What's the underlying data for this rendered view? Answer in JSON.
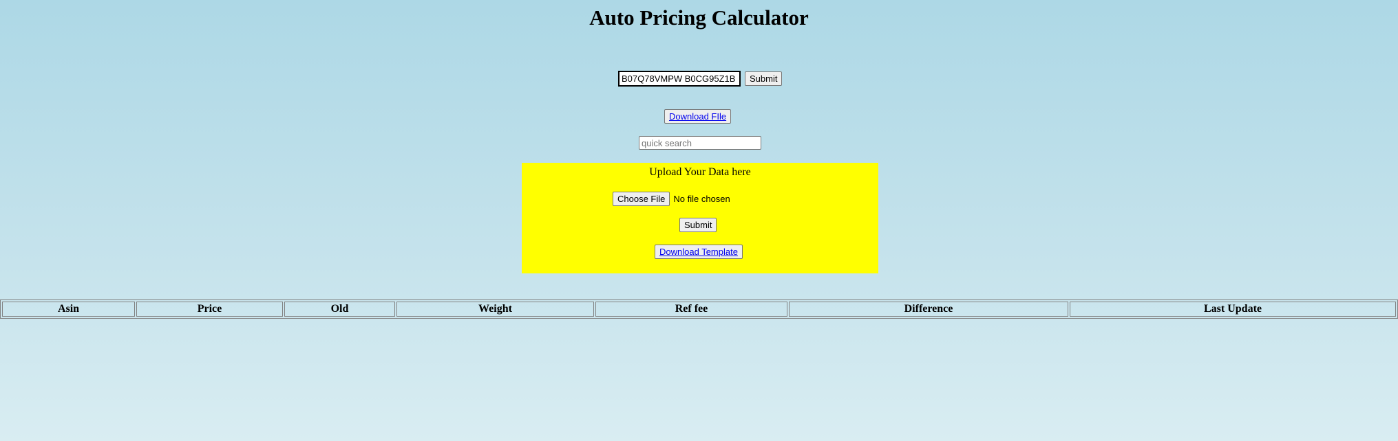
{
  "page": {
    "title": "Auto Pricing Calculator"
  },
  "asin_form": {
    "input_value": "B07Q78VMPW B0CG95Z1B",
    "submit_label": "Submit"
  },
  "download_file": {
    "label": "Download FIle"
  },
  "quick_search": {
    "placeholder": "quick search"
  },
  "upload": {
    "heading": "Upload Your Data here",
    "choose_file_label": "Choose File",
    "file_status": "No file chosen",
    "submit_label": "Submit",
    "template_label": "Download Template",
    "background_color": "#ffff00"
  },
  "table": {
    "columns": [
      "Asin",
      "Price",
      "Old",
      "Weight",
      "Ref fee",
      "Difference",
      "Last Update"
    ]
  }
}
